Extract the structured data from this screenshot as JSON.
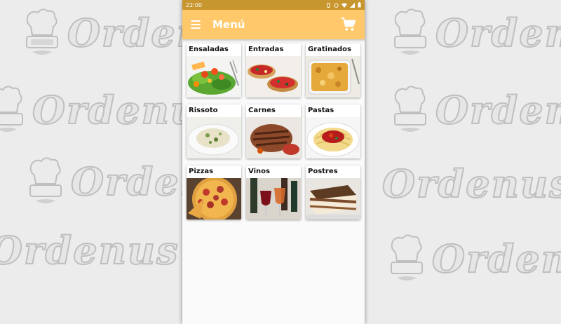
{
  "watermark": {
    "text": "Ordenus"
  },
  "status_bar": {
    "time": "22:00"
  },
  "app_bar": {
    "title": "Menú"
  },
  "menu": {
    "categories": [
      {
        "label": "Ensaladas"
      },
      {
        "label": "Entradas"
      },
      {
        "label": "Gratinados"
      },
      {
        "label": "Rissoto"
      },
      {
        "label": "Carnes"
      },
      {
        "label": "Pastas"
      },
      {
        "label": "Pizzas"
      },
      {
        "label": "Vinos"
      },
      {
        "label": "Postres"
      }
    ]
  },
  "colors": {
    "app_bar": "#ffc96b",
    "status_bar": "#c8962e",
    "background": "#ececec"
  },
  "icons": {
    "menu": "hamburger-icon",
    "cart": "shopping-cart-icon"
  }
}
